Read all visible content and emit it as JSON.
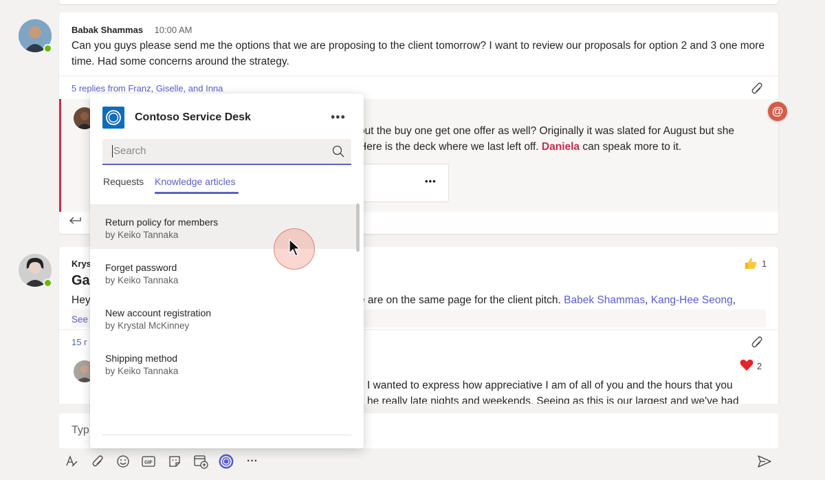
{
  "post1": {
    "author": "Babak Shammas",
    "time": "10:00 AM",
    "message": "Can you guys please send me the options that we are proposing to the client tomorrow? I want to review our proposals for option 2 and 3 one more time. Had some concerns around the strategy.",
    "replies_link": "5 replies from Franz, Giselle, and Inna"
  },
  "reply1": {
    "text_line1": "out the buy one get one offer as well? Originally it was slated for August but she",
    "text_line2_before": "Here is the deck where we last left off. ",
    "text_mention": "Daniela",
    "text_line2_after": " can speak more to it.",
    "card_more": "•••"
  },
  "post2": {
    "author_partial": "Krys",
    "title_partial": "Ga",
    "text_prefix": "Hey",
    "text_mid": "e are on the same page for the client pitch. ",
    "mention1": "Babek Shammas",
    "sep": ", ",
    "mention2": "Kang-Hee Seong",
    "trail": ",",
    "see_more_partial": "See",
    "replies_partial": "15 r",
    "reaction_like_count": "1",
    "reply_text1": "I wanted to express how appreciative I am of all of you and the hours that you",
    "reply_text2": "he really late nights and weekends. Seeing as this is our largest and we've had",
    "reaction_heart_count": "2"
  },
  "mention_badge": "@",
  "compose": {
    "placeholder": "Typ"
  },
  "popup": {
    "app_title": "Contoso Service Desk",
    "more": "•••",
    "search_placeholder": "Search",
    "tabs": [
      {
        "label": "Requests"
      },
      {
        "label": "Knowledge articles"
      }
    ],
    "articles": [
      {
        "title": "Return policy for members",
        "author": "by Keiko Tannaka"
      },
      {
        "title": "Forget password",
        "author": "by Keiko Tannaka"
      },
      {
        "title": "New account registration",
        "author": "by Krystal McKinney"
      },
      {
        "title": "Shipping method",
        "author": "by Keiko Tannaka"
      }
    ]
  },
  "toolbar": {
    "icons": [
      "format-icon",
      "attach-icon",
      "emoji-icon",
      "gif-icon",
      "sticker-icon",
      "meet-icon",
      "contoso-app-icon",
      "more-icon",
      "send-icon"
    ],
    "more": "···"
  },
  "colors": {
    "accent": "#5b5fc7",
    "mention": "#c4314b",
    "app": "#0f6cbd"
  }
}
